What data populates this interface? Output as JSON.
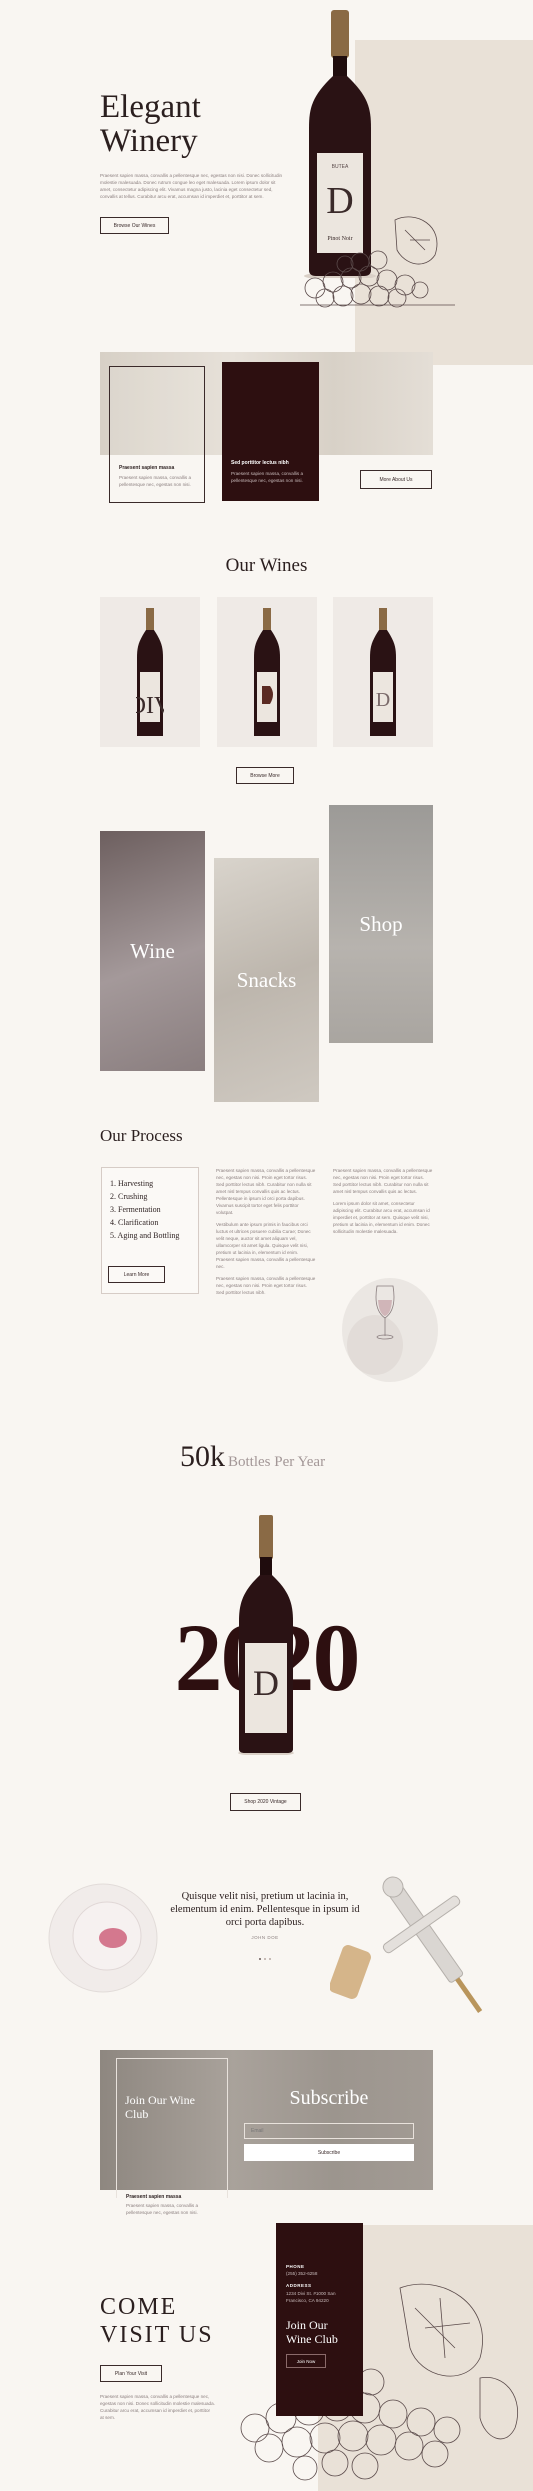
{
  "hero": {
    "title_line1": "Elegant",
    "title_line2": "Winery",
    "body": "Praesent sapien massa, convallis a pellentesque nec, egestas non nisi. Donec sollicitudin molestie malesuada. Donec rutrum congue leo eget malesuada. Lorem ipsum dolor sit amet, consectetur adipiscing elit. Vivamus magna justo, lacinia eget consectetur sed, convallis at tellus. Curabitur arcu erat, accumsan id imperdiet et, porttitor at sem.",
    "button": "Browse Our Wines",
    "label_brand": "BUTEA",
    "label_name": "Pinot Noir"
  },
  "about": {
    "card1_title": "Praesent sapien massa",
    "card1_body": "Praesent sapien massa, convallis a pellentesque nec, egestas non nisi.",
    "card2_title": "Sed porttitor lectus nibh",
    "card2_body": "Praesent sapien massa, convallis a pellentesque nec, egestas non nisi.",
    "button": "More About Us"
  },
  "wines": {
    "heading": "Our Wines",
    "button": "Browse More"
  },
  "categories": {
    "wine": "Wine",
    "snacks": "Snacks",
    "shop": "Shop"
  },
  "process": {
    "heading": "Our Process",
    "steps": [
      "1. Harvesting",
      "2. Crushing",
      "3. Fermentation",
      "4. Clarification",
      "5. Aging and Bottling"
    ],
    "button": "Learn More",
    "col1_p1": "Praesent sapien massa, convallis a pellentesque nec, egestas non nisi. Proin eget tortor risus. Sed porttitor lectus nibh. Curabitur non nulla sit amet nisl tempus convallis quis ac lectus. Pellentesque in ipsum id orci porta dapibus. Vivamus suscipit tortor eget felis porttitor volutpat.",
    "col1_p2": "Vestibulum ante ipsum primis in faucibus orci luctus et ultrices posuere cubilia Curae; Donec velit neque, auctor sit amet aliquam vel, ullamcorper sit amet ligula. Quisque velit nisi, pretium ut lacinia in, elementum id enim. Praesent sapien massa, convallis a pellentesque nec.",
    "col1_p3": "Praesent sapien massa, convallis a pellentesque nec, egestas non nisi. Proin eget tortor risus. Sed porttitor lectus nibh.",
    "col2_p1": "Praesent sapien massa, convallis a pellentesque nec, egestas non nisi. Proin eget tortor risus. Sed porttitor lectus nibh. Curabitur non nulla sit amet nisl tempus convallis quis ac lectus.",
    "col2_p2": "Lorem ipsum dolor sit amet, consectetur adipiscing elit. Curabitur arcu erat, accumsan id imperdiet et, porttitor at sem. Quisque velit nisi, pretium ut lacinia in, elementum id enim. Donec sollicitudin molestie malesuada."
  },
  "stats": {
    "number": "50k",
    "label": "Bottles Per Year",
    "year": "2020",
    "button": "Shop 2020 Vintage"
  },
  "testimonial": {
    "quote": "Quisque velit nisi, pretium ut lacinia in, elementum id enim. Pellentesque in ipsum id orci porta dapibus.",
    "author": "JOHN DOE"
  },
  "club": {
    "title": "Join Our Wine Club",
    "subscribe": "Subscribe",
    "email_placeholder": "Email",
    "subscribe_button": "Subscribe",
    "card_title": "Praesent sapien massa",
    "card_body": "Praesent sapien massa, convallis a pellentesque nec, egestas non nisi."
  },
  "visit": {
    "line1": "COME",
    "line2": "VISIT US",
    "button": "Plan Your Visit",
    "body": "Praesent sapien massa, convallis a pellentesque nec, egestas non nisi. Donec sollicitudin molestie malesuada. Curabitur arcu erat, accumsan id imperdiet et, porttitor at sem.",
    "phone_label": "PHONE",
    "phone": "(255) 352-6258",
    "address_label": "ADDRESS",
    "address": "1234 Divi St. #1000 San Francisco, CA 94220",
    "club_title": "Join Our Wine Club",
    "club_button": "Join Now"
  },
  "colors": {
    "background": "#f9f6f2",
    "accent_dark": "#2d0f10",
    "beige": "#e9e1d7"
  }
}
